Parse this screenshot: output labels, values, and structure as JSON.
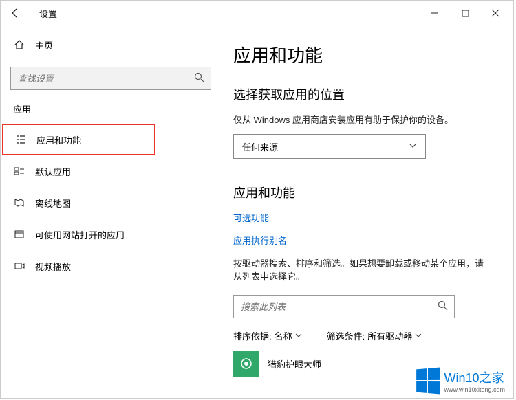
{
  "titlebar": {
    "app_name": "设置"
  },
  "sidebar": {
    "home_label": "主页",
    "search_placeholder": "查找设置",
    "section_label": "应用",
    "items": [
      {
        "label": "应用和功能"
      },
      {
        "label": "默认应用"
      },
      {
        "label": "离线地图"
      },
      {
        "label": "可使用网站打开的应用"
      },
      {
        "label": "视频播放"
      }
    ]
  },
  "main": {
    "page_title": "应用和功能",
    "section1_title": "选择获取应用的位置",
    "section1_help": "仅从 Windows 应用商店安装应用有助于保护你的设备。",
    "source_select": "任何来源",
    "section2_title": "应用和功能",
    "link1": "可选功能",
    "link2": "应用执行别名",
    "section2_help": "按驱动器搜索、排序和筛选。如果想要卸载或移动某个应用，请从列表中选择它。",
    "list_search_placeholder": "搜索此列表",
    "sort_label": "排序依据:",
    "sort_value": "名称",
    "filter_label": "筛选条件:",
    "filter_value": "所有驱动器",
    "app_item": "猎豹护眼大师"
  },
  "watermark": {
    "title": "Win10之家",
    "url": "www.win10xitong.com"
  }
}
